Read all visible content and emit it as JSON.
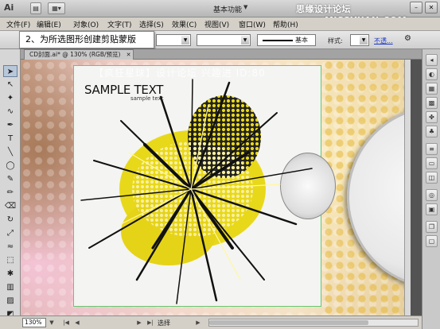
{
  "app": {
    "logo": "Ai",
    "workspace": "基本功能",
    "watermark_top": "思缘设计论坛 www.MISSYUAN.COM"
  },
  "menubar": {
    "items": [
      "文件(F)",
      "编辑(E)",
      "对象(O)",
      "文字(T)",
      "选择(S)",
      "效果(C)",
      "视图(V)",
      "窗口(W)",
      "帮助(H)"
    ]
  },
  "controlbar": {
    "stroke_style": "基本",
    "style_label": "样式:",
    "opacity_link": "不透..."
  },
  "callout": {
    "text": "2、为所选图形创建剪贴蒙版"
  },
  "document": {
    "tab_label": "CD封面.ai* @ 130% (RGB/预览)",
    "canvas_watermark": "【疯狂星球】设计论坛 兴趣进 ID:80"
  },
  "artwork": {
    "title": "SAMPLE TEXT",
    "subtitle": "sample text"
  },
  "statusbar": {
    "zoom": "130%",
    "status_text": "选择"
  },
  "colors": {
    "artboard_border": "#67c771",
    "burst_yellow": "#e8d81a",
    "link_blue": "#1c37c8"
  }
}
